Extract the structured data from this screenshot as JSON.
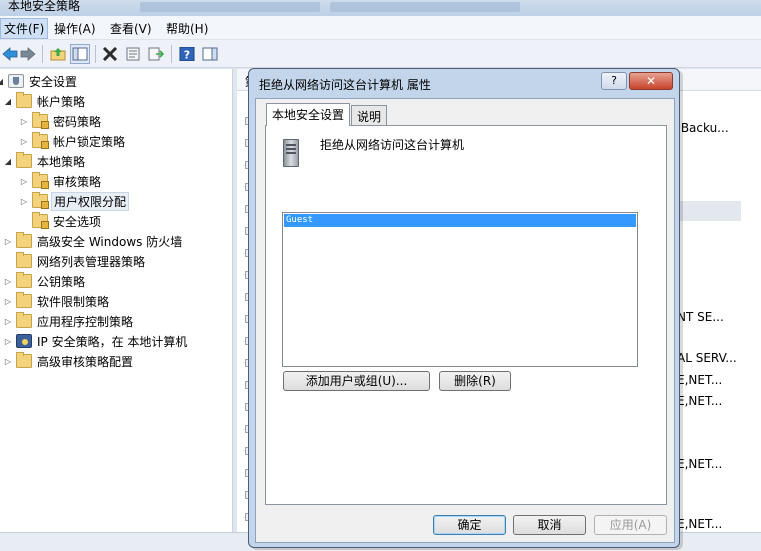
{
  "window": {
    "title": "本地安全策略"
  },
  "menu": [
    {
      "label": "文件(F)"
    },
    {
      "label": "操作(A)"
    },
    {
      "label": "查看(V)"
    },
    {
      "label": "帮助(H)"
    }
  ],
  "toolbar": {
    "icons": [
      "back-arrow-icon",
      "forward-arrow-icon",
      "up-folder-icon",
      "show-hide-tree-icon",
      "delete-icon",
      "properties-icon",
      "export-list-icon",
      "help-icon",
      "action-pane-icon"
    ]
  },
  "tree": {
    "items": [
      {
        "label": "安全设置",
        "icon": "security-settings-icon"
      },
      {
        "label": "帐户策略",
        "icon": "folder-icon"
      },
      {
        "label": "密码策略",
        "icon": "locked-folder-icon"
      },
      {
        "label": "帐户锁定策略",
        "icon": "locked-folder-icon"
      },
      {
        "label": "本地策略",
        "icon": "folder-icon"
      },
      {
        "label": "审核策略",
        "icon": "locked-folder-icon"
      },
      {
        "label": "用户权限分配",
        "icon": "locked-folder-icon"
      },
      {
        "label": "安全选项",
        "icon": "locked-folder-icon"
      },
      {
        "label": "高级安全 Windows 防火墙",
        "icon": "folder-icon"
      },
      {
        "label": "网络列表管理器策略",
        "icon": "folder-icon"
      },
      {
        "label": "公钥策略",
        "icon": "folder-icon"
      },
      {
        "label": "软件限制策略",
        "icon": "folder-icon"
      },
      {
        "label": "应用程序控制策略",
        "icon": "folder-icon"
      },
      {
        "label": "IP 安全策略，在 本地计算机",
        "icon": "ip-security-icon"
      },
      {
        "label": "高级审核策略配置",
        "icon": "folder-icon"
      }
    ]
  },
  "background_pane": {
    "column_header": "策",
    "visible_values": [
      ",Backu...",
      "NT SE...",
      "AL SERV...",
      "E,NET...",
      "E,NET...",
      "E,NET...",
      "E,NET..."
    ]
  },
  "dialog": {
    "title": "拒绝从网络访问这台计算机 属性",
    "help_label": "?",
    "close_label": "✕",
    "tabs": [
      {
        "label": "本地安全设置"
      },
      {
        "label": "说明"
      }
    ],
    "policy_name": "拒绝从网络访问这台计算机",
    "members": [
      "Guest"
    ],
    "add_button": "添加用户或组(U)...",
    "remove_button": "删除(R)",
    "ok_button": "确定",
    "cancel_button": "取消",
    "apply_button": "应用(A)"
  }
}
